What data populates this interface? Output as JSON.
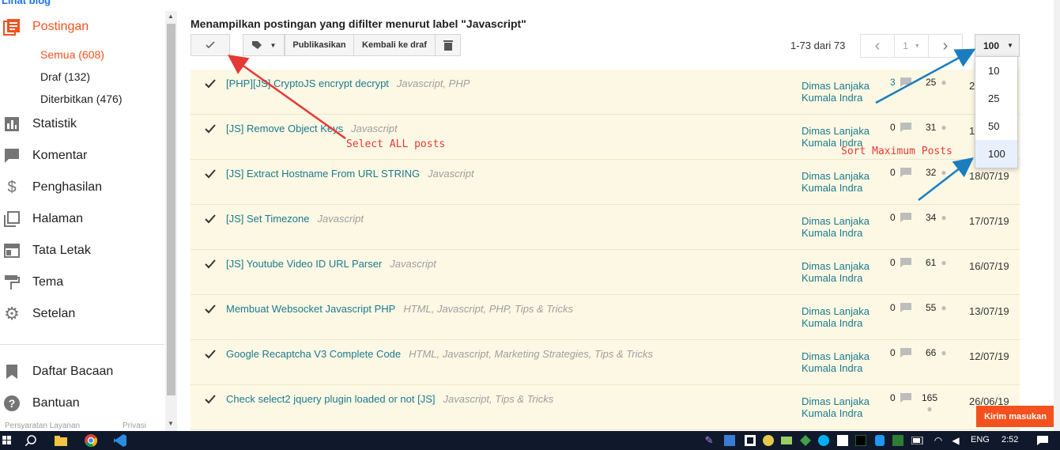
{
  "sidebar": {
    "view_blog": "Lihat blog",
    "posts_label": "Postingan",
    "sub_all": "Semua (608)",
    "sub_draft": "Draf (132)",
    "sub_published": "Diterbitkan (476)",
    "stats": "Statistik",
    "comments": "Komentar",
    "earnings": "Penghasilan",
    "pages": "Halaman",
    "layout": "Tata Letak",
    "theme": "Tema",
    "settings": "Setelan",
    "reading_list": "Daftar Bacaan",
    "help": "Bantuan",
    "footer_terms": "Persyaratan Layanan",
    "footer_privacy": "Privasi"
  },
  "header": {
    "title": "Menampilkan postingan yang difilter menurut label \"Javascript\"",
    "publish": "Publikasikan",
    "revert": "Kembali ke draf",
    "count": "1-73 dari 73",
    "page": "1",
    "per_page": "100"
  },
  "dropdown": {
    "options": [
      "10",
      "25",
      "50",
      "100"
    ],
    "selected": "100"
  },
  "posts": [
    {
      "title": "[PHP][JS] CryptoJS encrypt decrypt",
      "labels": "Javascript, PHP",
      "author1": "Dimas Lanjaka",
      "author2": "Kumala Indra",
      "comments": "3",
      "views": "25",
      "date": "2"
    },
    {
      "title": "[JS] Remove Object Keys",
      "labels": "Javascript",
      "author1": "Dimas Lanjaka",
      "author2": "Kumala Indra",
      "comments": "0",
      "views": "31",
      "date": "1"
    },
    {
      "title": "[JS] Extract Hostname From URL STRING",
      "labels": "Javascript",
      "author1": "Dimas Lanjaka",
      "author2": "Kumala Indra",
      "comments": "0",
      "views": "32",
      "date": "18/07/19"
    },
    {
      "title": "[JS] Set Timezone",
      "labels": "Javascript",
      "author1": "Dimas Lanjaka",
      "author2": "Kumala Indra",
      "comments": "0",
      "views": "34",
      "date": "17/07/19"
    },
    {
      "title": "[JS] Youtube Video ID URL Parser",
      "labels": "Javascript",
      "author1": "Dimas Lanjaka",
      "author2": "Kumala Indra",
      "comments": "0",
      "views": "61",
      "date": "16/07/19"
    },
    {
      "title": "Membuat Websocket Javascript PHP",
      "labels": "HTML, Javascript, PHP, Tips & Tricks",
      "author1": "Dimas Lanjaka",
      "author2": "Kumala Indra",
      "comments": "0",
      "views": "55",
      "date": "13/07/19"
    },
    {
      "title": "Google Recaptcha V3 Complete Code",
      "labels": "HTML, Javascript, Marketing Strategies, Tips & Tricks",
      "author1": "Dimas Lanjaka",
      "author2": "Kumala Indra",
      "comments": "0",
      "views": "66",
      "date": "12/07/19"
    },
    {
      "title": "Check select2 jquery plugin loaded or not [JS]",
      "labels": "Javascript, Tips & Tricks",
      "author1": "Dimas Lanjaka",
      "author2": "Kumala Indra",
      "comments": "0",
      "views": "165",
      "date": "26/06/19"
    }
  ],
  "annotations": {
    "select_all": "Select ALL posts",
    "sort_max": "Sort Maximum Posts"
  },
  "feedback": "Kirim masukan",
  "taskbar": {
    "lang": "ENG",
    "time": "2:52"
  },
  "colors": {
    "accent": "#f4511e",
    "link": "#1b7a8c",
    "row_bg": "#fdf8e4",
    "taskbar": "#10192b"
  }
}
